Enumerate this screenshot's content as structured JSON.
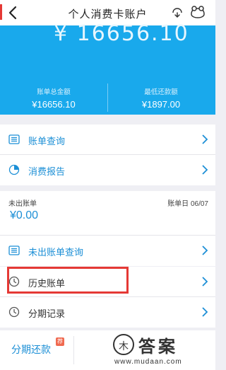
{
  "navbar": {
    "title": "个人消费卡账户"
  },
  "hero": {
    "balance": "¥ 16656.10",
    "total_label": "账单总金额",
    "total_value": "¥16656.10",
    "min_label": "最低还款额",
    "min_value": "¥1897.00"
  },
  "menu1": [
    {
      "label": "账单查询",
      "icon": "list-icon"
    },
    {
      "label": "消费报告",
      "icon": "pie-chart-icon"
    }
  ],
  "unbilled": {
    "label": "未出账单",
    "date_label": "账单日  06/07",
    "amount": "¥0.00",
    "query_label": "未出账单查询"
  },
  "menu2": [
    {
      "label": "历史账单",
      "icon": "clock-icon"
    },
    {
      "label": "分期记录",
      "icon": "clock-icon"
    }
  ],
  "bottom": {
    "installment_label": "分期还款",
    "badge": "荐"
  },
  "watermark": {
    "circle_char": "木",
    "text": "答案",
    "url": "www.mudaan.com"
  },
  "colors": {
    "accent": "#19a9ec",
    "link": "#1c8fd6",
    "highlight": "#e53935"
  }
}
